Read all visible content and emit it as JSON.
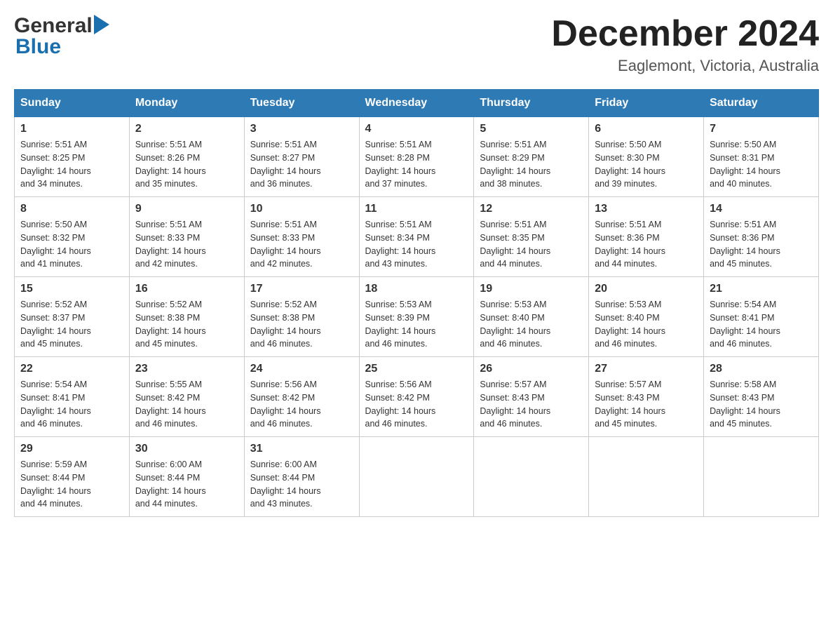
{
  "header": {
    "logo_general": "General",
    "logo_blue": "Blue",
    "month_title": "December 2024",
    "location": "Eaglemont, Victoria, Australia"
  },
  "weekdays": [
    "Sunday",
    "Monday",
    "Tuesday",
    "Wednesday",
    "Thursday",
    "Friday",
    "Saturday"
  ],
  "weeks": [
    [
      {
        "day": "1",
        "sunrise": "5:51 AM",
        "sunset": "8:25 PM",
        "daylight": "14 hours and 34 minutes."
      },
      {
        "day": "2",
        "sunrise": "5:51 AM",
        "sunset": "8:26 PM",
        "daylight": "14 hours and 35 minutes."
      },
      {
        "day": "3",
        "sunrise": "5:51 AM",
        "sunset": "8:27 PM",
        "daylight": "14 hours and 36 minutes."
      },
      {
        "day": "4",
        "sunrise": "5:51 AM",
        "sunset": "8:28 PM",
        "daylight": "14 hours and 37 minutes."
      },
      {
        "day": "5",
        "sunrise": "5:51 AM",
        "sunset": "8:29 PM",
        "daylight": "14 hours and 38 minutes."
      },
      {
        "day": "6",
        "sunrise": "5:50 AM",
        "sunset": "8:30 PM",
        "daylight": "14 hours and 39 minutes."
      },
      {
        "day": "7",
        "sunrise": "5:50 AM",
        "sunset": "8:31 PM",
        "daylight": "14 hours and 40 minutes."
      }
    ],
    [
      {
        "day": "8",
        "sunrise": "5:50 AM",
        "sunset": "8:32 PM",
        "daylight": "14 hours and 41 minutes."
      },
      {
        "day": "9",
        "sunrise": "5:51 AM",
        "sunset": "8:33 PM",
        "daylight": "14 hours and 42 minutes."
      },
      {
        "day": "10",
        "sunrise": "5:51 AM",
        "sunset": "8:33 PM",
        "daylight": "14 hours and 42 minutes."
      },
      {
        "day": "11",
        "sunrise": "5:51 AM",
        "sunset": "8:34 PM",
        "daylight": "14 hours and 43 minutes."
      },
      {
        "day": "12",
        "sunrise": "5:51 AM",
        "sunset": "8:35 PM",
        "daylight": "14 hours and 44 minutes."
      },
      {
        "day": "13",
        "sunrise": "5:51 AM",
        "sunset": "8:36 PM",
        "daylight": "14 hours and 44 minutes."
      },
      {
        "day": "14",
        "sunrise": "5:51 AM",
        "sunset": "8:36 PM",
        "daylight": "14 hours and 45 minutes."
      }
    ],
    [
      {
        "day": "15",
        "sunrise": "5:52 AM",
        "sunset": "8:37 PM",
        "daylight": "14 hours and 45 minutes."
      },
      {
        "day": "16",
        "sunrise": "5:52 AM",
        "sunset": "8:38 PM",
        "daylight": "14 hours and 45 minutes."
      },
      {
        "day": "17",
        "sunrise": "5:52 AM",
        "sunset": "8:38 PM",
        "daylight": "14 hours and 46 minutes."
      },
      {
        "day": "18",
        "sunrise": "5:53 AM",
        "sunset": "8:39 PM",
        "daylight": "14 hours and 46 minutes."
      },
      {
        "day": "19",
        "sunrise": "5:53 AM",
        "sunset": "8:40 PM",
        "daylight": "14 hours and 46 minutes."
      },
      {
        "day": "20",
        "sunrise": "5:53 AM",
        "sunset": "8:40 PM",
        "daylight": "14 hours and 46 minutes."
      },
      {
        "day": "21",
        "sunrise": "5:54 AM",
        "sunset": "8:41 PM",
        "daylight": "14 hours and 46 minutes."
      }
    ],
    [
      {
        "day": "22",
        "sunrise": "5:54 AM",
        "sunset": "8:41 PM",
        "daylight": "14 hours and 46 minutes."
      },
      {
        "day": "23",
        "sunrise": "5:55 AM",
        "sunset": "8:42 PM",
        "daylight": "14 hours and 46 minutes."
      },
      {
        "day": "24",
        "sunrise": "5:56 AM",
        "sunset": "8:42 PM",
        "daylight": "14 hours and 46 minutes."
      },
      {
        "day": "25",
        "sunrise": "5:56 AM",
        "sunset": "8:42 PM",
        "daylight": "14 hours and 46 minutes."
      },
      {
        "day": "26",
        "sunrise": "5:57 AM",
        "sunset": "8:43 PM",
        "daylight": "14 hours and 46 minutes."
      },
      {
        "day": "27",
        "sunrise": "5:57 AM",
        "sunset": "8:43 PM",
        "daylight": "14 hours and 45 minutes."
      },
      {
        "day": "28",
        "sunrise": "5:58 AM",
        "sunset": "8:43 PM",
        "daylight": "14 hours and 45 minutes."
      }
    ],
    [
      {
        "day": "29",
        "sunrise": "5:59 AM",
        "sunset": "8:44 PM",
        "daylight": "14 hours and 44 minutes."
      },
      {
        "day": "30",
        "sunrise": "6:00 AM",
        "sunset": "8:44 PM",
        "daylight": "14 hours and 44 minutes."
      },
      {
        "day": "31",
        "sunrise": "6:00 AM",
        "sunset": "8:44 PM",
        "daylight": "14 hours and 43 minutes."
      },
      null,
      null,
      null,
      null
    ]
  ],
  "labels": {
    "sunrise": "Sunrise:",
    "sunset": "Sunset:",
    "daylight": "Daylight:"
  }
}
